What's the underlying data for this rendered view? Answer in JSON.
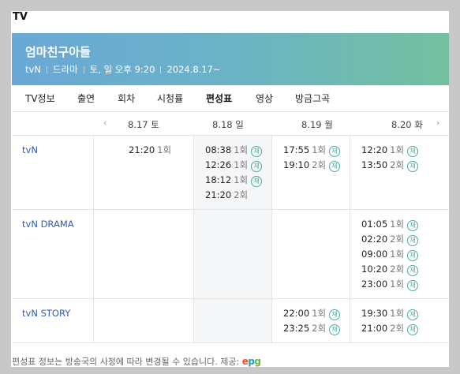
{
  "page": {
    "top_title": "TV"
  },
  "program": {
    "title": "엄마친구아들",
    "channel": "tvN",
    "genre": "드라마",
    "schedule": "토, 일 오후 9:20",
    "start": "2024.8.17~"
  },
  "tabs": [
    {
      "label": "TV정보",
      "active": false
    },
    {
      "label": "출연",
      "active": false
    },
    {
      "label": "회차",
      "active": false
    },
    {
      "label": "시청률",
      "active": false
    },
    {
      "label": "편성표",
      "active": true
    },
    {
      "label": "영상",
      "active": false
    },
    {
      "label": "방금그곡",
      "active": false
    }
  ],
  "schedule": {
    "prev_arrow": "‹",
    "next_arrow": "›",
    "days": [
      "8.17 토",
      "8.18 일",
      "8.19 월",
      "8.20 화"
    ],
    "rerun_label": "재",
    "channels": [
      {
        "name": "tvN",
        "days": [
          [
            {
              "time": "21:20",
              "ep": "1회",
              "rerun": false
            }
          ],
          [
            {
              "time": "08:38",
              "ep": "1회",
              "rerun": true
            },
            {
              "time": "12:26",
              "ep": "1회",
              "rerun": true
            },
            {
              "time": "18:12",
              "ep": "1회",
              "rerun": true
            },
            {
              "time": "21:20",
              "ep": "2회",
              "rerun": false
            }
          ],
          [
            {
              "time": "17:55",
              "ep": "1회",
              "rerun": true
            },
            {
              "time": "19:10",
              "ep": "2회",
              "rerun": true
            }
          ],
          [
            {
              "time": "12:20",
              "ep": "1회",
              "rerun": true
            },
            {
              "time": "13:50",
              "ep": "2회",
              "rerun": true
            }
          ]
        ]
      },
      {
        "name": "tvN DRAMA",
        "days": [
          [],
          [],
          [],
          [
            {
              "time": "01:05",
              "ep": "1회",
              "rerun": true
            },
            {
              "time": "02:20",
              "ep": "2회",
              "rerun": true
            },
            {
              "time": "09:00",
              "ep": "1회",
              "rerun": true
            },
            {
              "time": "10:20",
              "ep": "2회",
              "rerun": true
            },
            {
              "time": "23:00",
              "ep": "1회",
              "rerun": true
            }
          ]
        ]
      },
      {
        "name": "tvN STORY",
        "days": [
          [],
          [],
          [
            {
              "time": "22:00",
              "ep": "1회",
              "rerun": true
            },
            {
              "time": "23:25",
              "ep": "2회",
              "rerun": true
            }
          ],
          [
            {
              "time": "19:30",
              "ep": "1회",
              "rerun": true
            },
            {
              "time": "21:00",
              "ep": "2회",
              "rerun": true
            }
          ]
        ]
      }
    ]
  },
  "footer": {
    "text": "편성표 정보는 방송국의 사정에 따라 변경될 수 있습니다. 제공:",
    "provider_e": "e",
    "provider_p": "p",
    "provider_g": "g"
  },
  "colors": {
    "banner_start": "#6aa8d6",
    "banner_end": "#73c09e",
    "channel_link": "#2c5bbd",
    "rerun_badge": "#4aaea0",
    "highlight_column": "#f5f6f8"
  }
}
